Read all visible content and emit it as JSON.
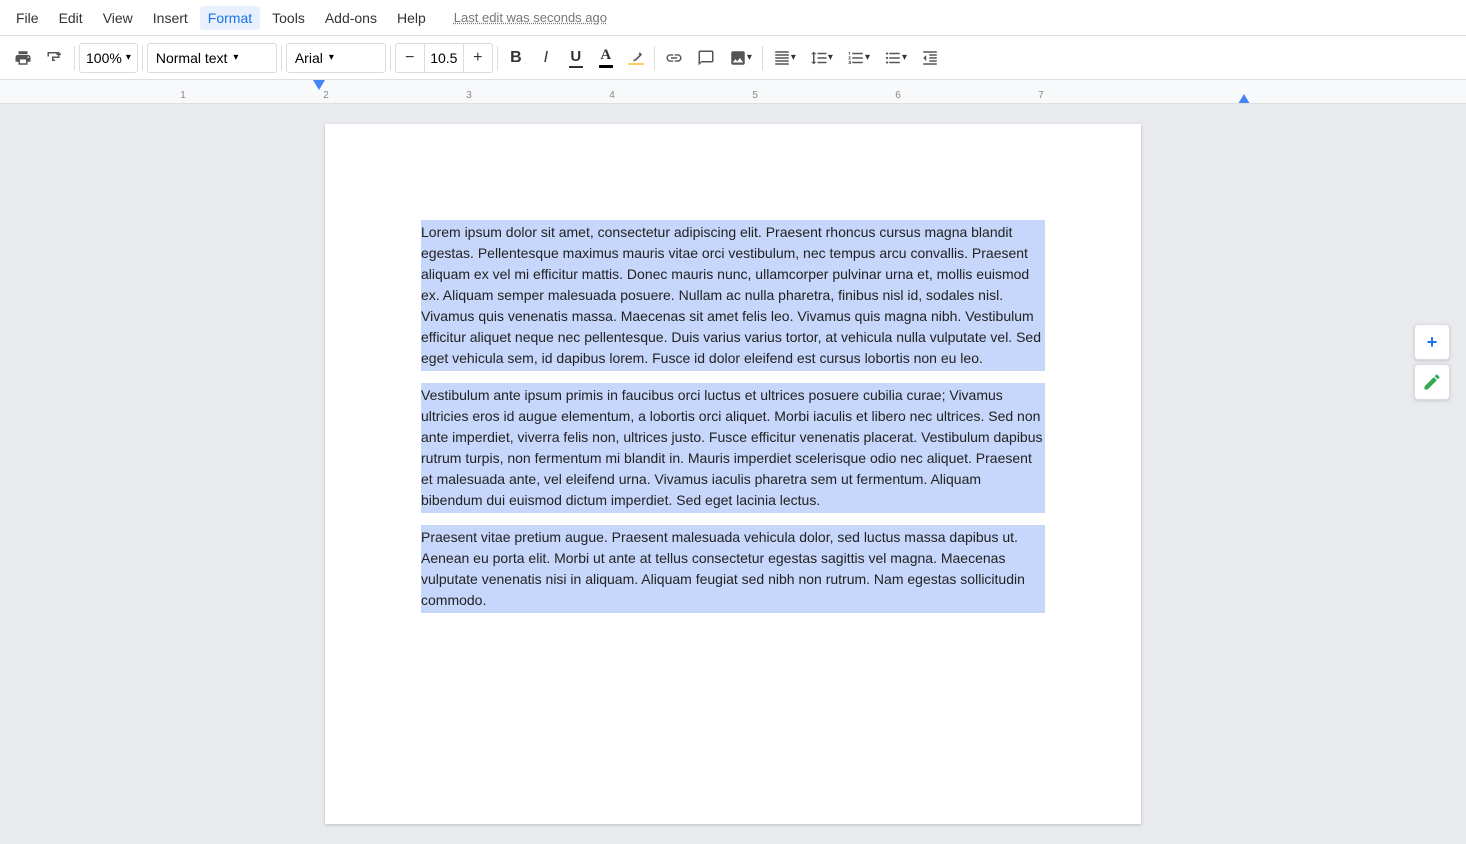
{
  "menu": {
    "items": [
      "File",
      "Edit",
      "View",
      "Insert",
      "Format",
      "Tools",
      "Add-ons",
      "Help"
    ],
    "active_item": "Format",
    "last_edit": "Last edit was seconds ago"
  },
  "toolbar": {
    "zoom": "100%",
    "text_style": "Normal text",
    "font": "Arial",
    "font_size": "10.5",
    "bold_label": "B",
    "italic_label": "I",
    "underline_label": "U",
    "minus_label": "−",
    "plus_label": "+"
  },
  "document": {
    "paragraphs": [
      "Lorem ipsum dolor sit amet, consectetur adipiscing elit. Praesent rhoncus cursus magna blandit egestas. Pellentesque maximus mauris vitae orci vestibulum, nec tempus arcu convallis. Praesent aliquam ex vel mi efficitur mattis. Donec mauris nunc, ullamcorper pulvinar urna et, mollis euismod ex. Aliquam semper malesuada posuere. Nullam ac nulla pharetra, finibus nisl id, sodales nisl. Vivamus quis venenatis massa. Maecenas sit amet felis leo. Vivamus quis magna nibh. Vestibulum efficitur aliquet neque nec pellentesque. Duis varius varius tortor, at vehicula nulla vulputate vel. Sed eget vehicula sem, id dapibus lorem. Fusce id dolor eleifend est cursus lobortis non eu leo.",
      "Vestibulum ante ipsum primis in faucibus orci luctus et ultrices posuere cubilia curae; Vivamus ultricies eros id augue elementum, a lobortis orci aliquet. Morbi iaculis et libero nec ultrices. Sed non ante imperdiet, viverra felis non, ultrices justo. Fusce efficitur venenatis placerat. Vestibulum dapibus rutrum turpis, non fermentum mi blandit in. Mauris imperdiet scelerisque odio nec aliquet. Praesent et malesuada ante, vel eleifend urna. Vivamus iaculis pharetra sem ut fermentum. Aliquam bibendum dui euismod dictum imperdiet. Sed eget lacinia lectus.",
      "Praesent vitae pretium augue. Praesent malesuada vehicula dolor, sed luctus massa dapibus ut. Aenean eu porta elit. Morbi ut ante at tellus consectetur egestas sagittis vel magna. Maecenas vulputate venenatis nisi in aliquam. Aliquam feugiat sed nibh non rutrum. Nam egestas sollicitudin commodo."
    ]
  },
  "side_buttons": {
    "add_label": "+",
    "edit_label": "✎"
  },
  "colors": {
    "selection_bg": "#b3c7f7",
    "accent_blue": "#1a73e8",
    "accent_green": "#34a853"
  }
}
